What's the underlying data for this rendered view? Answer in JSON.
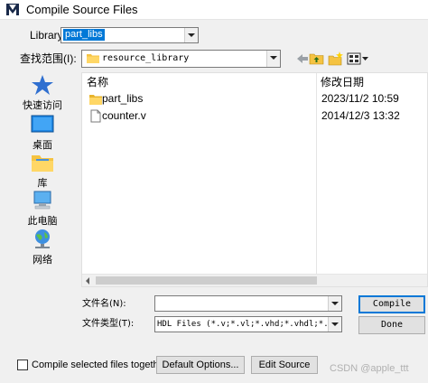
{
  "window": {
    "title": "Compile Source Files",
    "app_icon": "modelsim-m-icon"
  },
  "library": {
    "label": "Library:",
    "value": "part_libs"
  },
  "look_in": {
    "label": "查找范围(I):",
    "value": "resource_library"
  },
  "toolbar": {
    "icons": [
      "back-arrow-icon",
      "up-folder-icon",
      "new-folder-icon",
      "view-menu-icon"
    ]
  },
  "places": [
    {
      "label": "快速访问",
      "icon": "star-icon"
    },
    {
      "label": "桌面",
      "icon": "desktop-icon"
    },
    {
      "label": "库",
      "icon": "library-icon"
    },
    {
      "label": "此电脑",
      "icon": "computer-icon"
    },
    {
      "label": "网络",
      "icon": "network-icon"
    }
  ],
  "file_list": {
    "columns": {
      "name": "名称",
      "date": "修改日期"
    },
    "rows": [
      {
        "name": "part_libs",
        "date": "2023/11/2 10:59",
        "type": "folder"
      },
      {
        "name": "counter.v",
        "date": "2014/12/3 13:32",
        "type": "file"
      }
    ]
  },
  "filename": {
    "label": "文件名(N):",
    "value": ""
  },
  "filetype": {
    "label": "文件类型(T):",
    "value": "HDL Files (*.v;*.vl;*.vhd;*.vhdl;*.vh"
  },
  "buttons": {
    "compile": "Compile",
    "done": "Done",
    "default_options": "Default Options...",
    "edit_source": "Edit Source"
  },
  "compile_together": {
    "label": "Compile selected files together",
    "checked": false
  },
  "watermark": "CSDN @apple_ttt",
  "colors": {
    "selection": "#0078d7",
    "folder": "#f5c342"
  }
}
